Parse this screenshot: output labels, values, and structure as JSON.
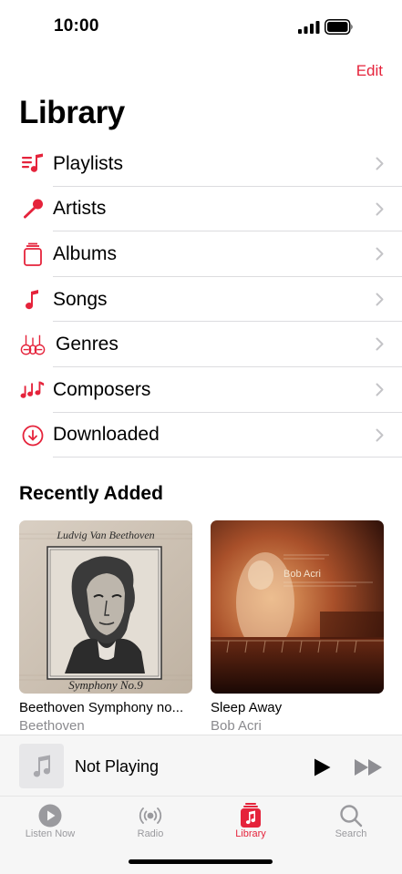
{
  "status": {
    "time": "10:00"
  },
  "header": {
    "edit_label": "Edit",
    "title": "Library"
  },
  "menu": [
    {
      "label": "Playlists",
      "icon": "playlist-icon"
    },
    {
      "label": "Artists",
      "icon": "microphone-icon"
    },
    {
      "label": "Albums",
      "icon": "albums-icon"
    },
    {
      "label": "Songs",
      "icon": "music-note-icon"
    },
    {
      "label": "Genres",
      "icon": "guitars-icon"
    },
    {
      "label": "Composers",
      "icon": "music-notes-icon"
    },
    {
      "label": "Downloaded",
      "icon": "download-circle-icon"
    }
  ],
  "recently_added": {
    "title": "Recently Added",
    "albums": [
      {
        "name": "Beethoven Symphony no...",
        "artist": "Beethoven",
        "art_script_top": "Ludvig Van Beethoven",
        "art_script_bottom": "Symphony No.9"
      },
      {
        "name": "Sleep Away",
        "artist": "Bob Acri",
        "art_title": "Bob Acri"
      }
    ]
  },
  "mini_player": {
    "title": "Not Playing"
  },
  "tabs": [
    {
      "label": "Listen Now",
      "icon": "play-circle-icon"
    },
    {
      "label": "Radio",
      "icon": "radio-icon"
    },
    {
      "label": "Library",
      "icon": "library-icon",
      "active": true
    },
    {
      "label": "Search",
      "icon": "search-icon"
    }
  ],
  "colors": {
    "accent": "#e5233b",
    "secondary_text": "#8a8a8e",
    "separator": "#dcdcdf"
  }
}
